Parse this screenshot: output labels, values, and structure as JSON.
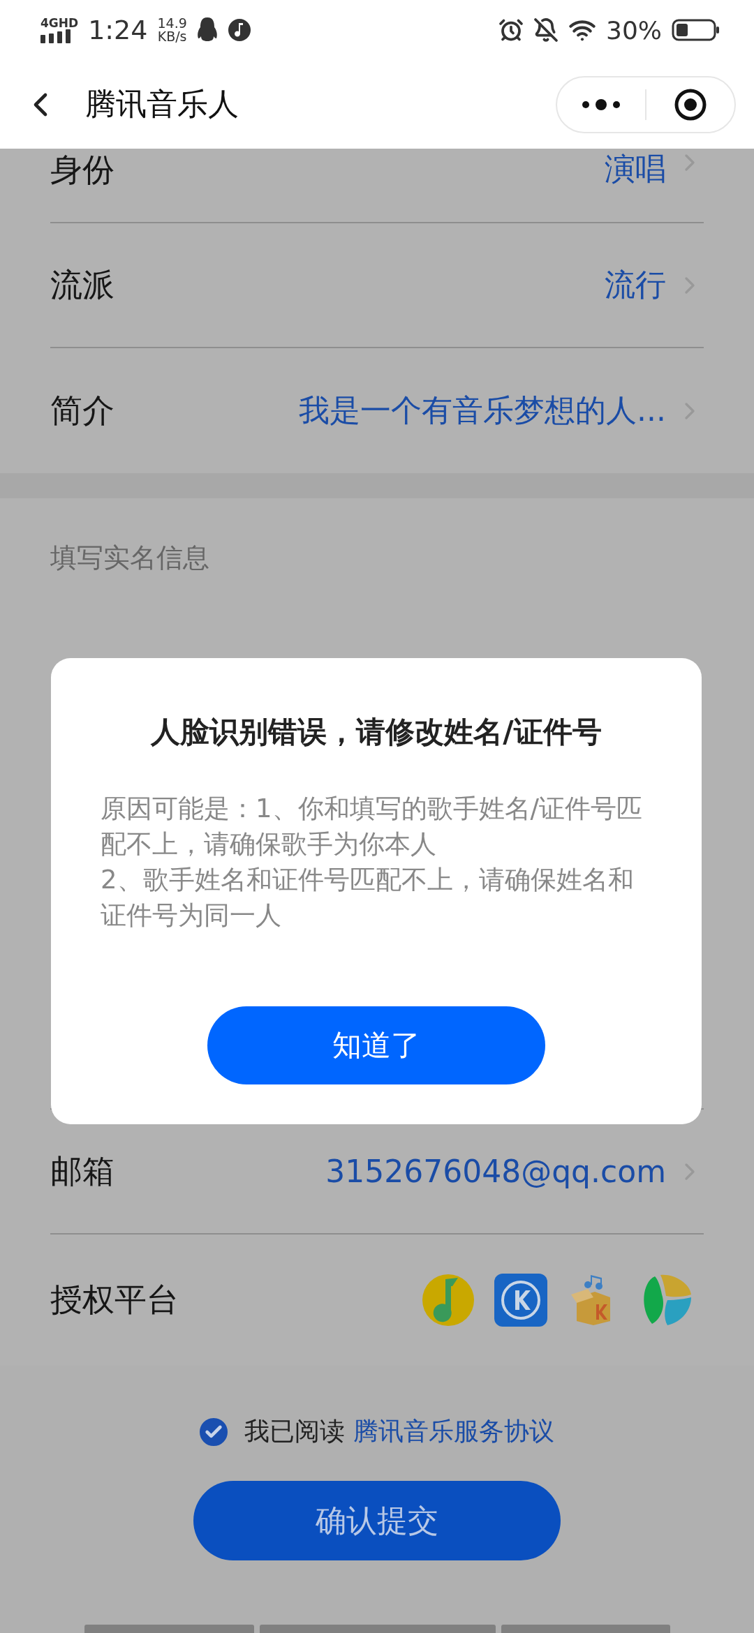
{
  "status_bar": {
    "network": "4GHD",
    "time": "1:24",
    "speed_value": "14.9",
    "speed_unit": "KB/s",
    "battery": "30%"
  },
  "nav": {
    "title": "腾讯音乐人"
  },
  "profile_rows": [
    {
      "label": "身份",
      "value": "演唱"
    },
    {
      "label": "流派",
      "value": "流行"
    },
    {
      "label": "简介",
      "value": "我是一个有音乐梦想的人..."
    }
  ],
  "real_name_section": {
    "header": "填写实名信息",
    "rows": [
      {
        "label": "邮箱",
        "value": "3152676048@qq.com"
      }
    ]
  },
  "platforms": {
    "label": "授权平台"
  },
  "agreement": {
    "checked": true,
    "text": "我已阅读",
    "link": "腾讯音乐服务协议"
  },
  "submit_button": "确认提交",
  "dialog": {
    "title": "人脸识别错误，请修改姓名/证件号",
    "message_lines": [
      "原因可能是：1、你和填写的歌手姓名/证件号匹配不上，请确保歌手为你本人",
      "2、歌手姓名和证件号匹配不上，请确保姓名和证件号为同一人"
    ],
    "button": "知道了"
  }
}
